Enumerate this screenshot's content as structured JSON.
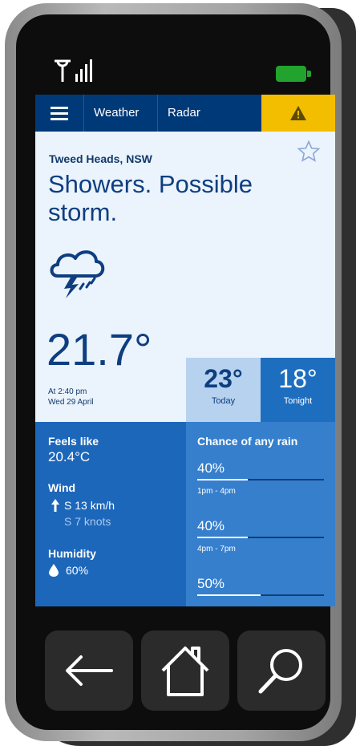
{
  "nav": {
    "menu_icon": "hamburger-menu-icon",
    "tabs": [
      "Weather",
      "Radar"
    ],
    "warning_icon": "warning-triangle-icon"
  },
  "location": "Tweed Heads, NSW",
  "forecast": {
    "summary": "Showers. Possible storm.",
    "icon": "storm-cloud-icon",
    "current_temp": "21.7°",
    "time": "At 2:40 pm",
    "date": "Wed 29 April",
    "today": {
      "temp": "23°",
      "label": "Today"
    },
    "tonight": {
      "temp": "18°",
      "label": "Tonight"
    }
  },
  "details": {
    "feels_like_label": "Feels like",
    "feels_like_value": "20.4°C",
    "wind_label": "Wind",
    "wind_kmh": "S  13 km/h",
    "wind_knots": "S  7 knots",
    "humidity_label": "Humidity",
    "humidity_value": "60%"
  },
  "rain": {
    "title": "Chance of any rain",
    "periods": [
      {
        "percent": "40%",
        "value": 0.4,
        "time": "1pm - 4pm"
      },
      {
        "percent": "40%",
        "value": 0.4,
        "time": "4pm - 7pm"
      },
      {
        "percent": "50%",
        "value": 0.5,
        "time": ""
      }
    ]
  },
  "device": {
    "battery_color": "#22a32d",
    "buttons": [
      "back-arrow-icon",
      "home-icon",
      "search-magnifier-icon"
    ]
  },
  "colors": {
    "nav": "#003978",
    "warning": "#f3bd00",
    "text": "#0d3e80",
    "panel_dark": "#1d67bb",
    "panel_mid": "#357fcd"
  }
}
